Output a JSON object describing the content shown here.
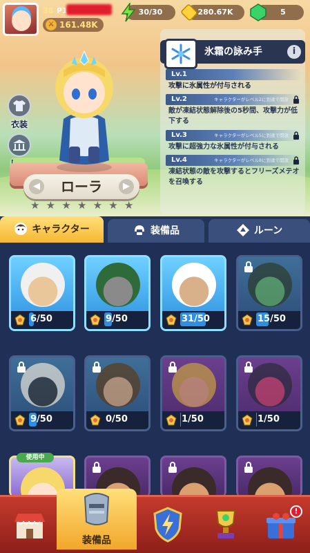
{
  "player": {
    "level": "38",
    "name_prefix": "P1",
    "power": "161.48K"
  },
  "resources": {
    "stamina": "30/30",
    "gold": "280.67K",
    "gems": "5"
  },
  "side_buttons": {
    "costume": "衣装",
    "hall": "殿堂"
  },
  "hero": {
    "name": "ローラ",
    "stars": 7
  },
  "skill": {
    "name": "氷霜の詠み手",
    "levels": [
      {
        "tag": "Lv.1",
        "req": "",
        "desc": "攻撃に氷属性が付与される",
        "locked": false
      },
      {
        "tag": "Lv.2",
        "req": "キャラクターがレベル2に到達で開放",
        "desc": "敵が凍結状態解除後の5秒間、攻撃力が低下する",
        "locked": true
      },
      {
        "tag": "Lv.3",
        "req": "キャラクターがレベル5に到達で開放",
        "desc": "攻撃に超強力な氷属性が付与される",
        "locked": true
      },
      {
        "tag": "Lv.4",
        "req": "キャラクターがレベル8に到達で開放",
        "desc": "凍結状態の敵を攻撃するとフリーズメテオを召喚する",
        "locked": true
      }
    ]
  },
  "tabs": {
    "character": "キャラクター",
    "equipment": "装備品",
    "rune": "ルーン"
  },
  "characters": [
    {
      "count": "6/50",
      "progress": 0.12,
      "locked": false,
      "frame": "blue"
    },
    {
      "count": "9/50",
      "progress": 0.18,
      "locked": false,
      "frame": "blue"
    },
    {
      "count": "31/50",
      "progress": 0.62,
      "locked": false,
      "frame": "blue"
    },
    {
      "count": "15/50",
      "progress": 0.3,
      "locked": true,
      "frame": "blue"
    },
    {
      "count": "9/50",
      "progress": 0.18,
      "locked": true,
      "frame": "blue"
    },
    {
      "count": "0/50",
      "progress": 0.0,
      "locked": true,
      "frame": "blue"
    },
    {
      "count": "1/50",
      "progress": 0.02,
      "locked": true,
      "frame": "purple"
    },
    {
      "count": "1/50",
      "progress": 0.02,
      "locked": true,
      "frame": "purple"
    }
  ],
  "in_use_label": "使用中",
  "nav": {
    "equipment": "装備品",
    "badge": "!"
  }
}
